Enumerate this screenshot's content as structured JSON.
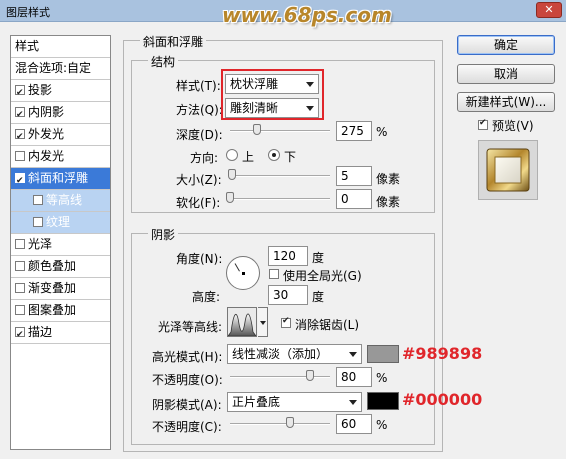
{
  "window": {
    "title": "图层样式",
    "close": "✕",
    "watermark": "www.68ps.com"
  },
  "left_panel": {
    "header": "样式",
    "blend": "混合选项:自定",
    "items": [
      {
        "label": "投影",
        "checked": true
      },
      {
        "label": "内阴影",
        "checked": true
      },
      {
        "label": "外发光",
        "checked": true
      },
      {
        "label": "内发光",
        "checked": false
      },
      {
        "label": "斜面和浮雕",
        "checked": true,
        "selected": true
      },
      {
        "label": "等高线",
        "checked": false,
        "sub": true
      },
      {
        "label": "纹理",
        "checked": false,
        "sub": true
      },
      {
        "label": "光泽",
        "checked": false
      },
      {
        "label": "颜色叠加",
        "checked": false
      },
      {
        "label": "渐变叠加",
        "checked": false
      },
      {
        "label": "图案叠加",
        "checked": false
      },
      {
        "label": "描边",
        "checked": true
      }
    ]
  },
  "bevel": {
    "title": "斜面和浮雕",
    "structure": {
      "title": "结构",
      "style_label": "样式(T):",
      "style_value": "枕状浮雕",
      "technique_label": "方法(Q):",
      "technique_value": "雕刻清晰",
      "depth_label": "深度(D):",
      "depth_value": "275",
      "depth_unit": "%",
      "depth_level": 0.27,
      "direction_label": "方向:",
      "direction_up": "上",
      "direction_down": "下",
      "size_label": "大小(Z):",
      "size_value": "5",
      "size_unit": "像素",
      "size_level": 0.02,
      "soften_label": "软化(F):",
      "soften_value": "0",
      "soften_unit": "像素",
      "soften_level": 0.0
    },
    "shading": {
      "title": "阴影",
      "angle_label": "角度(N):",
      "angle_value": "120",
      "angle_unit": "度",
      "global_light": "使用全局光(G)",
      "altitude_label": "高度:",
      "altitude_value": "30",
      "altitude_unit": "度",
      "gloss_label": "光泽等高线:",
      "anti_alias": "消除锯齿(L)",
      "highlight_label": "高光模式(H):",
      "highlight_value": "线性减淡（添加）",
      "highlight_color": "#989898",
      "highlight_hex": "#989898",
      "opacity1_label": "不透明度(O):",
      "opacity1_value": "80",
      "opacity1_unit": "%",
      "opacity1_level": 0.8,
      "shadow_label": "阴影模式(A):",
      "shadow_value": "正片叠底",
      "shadow_color": "#000000",
      "shadow_hex": "#000000",
      "opacity2_label": "不透明度(C):",
      "opacity2_value": "60",
      "opacity2_unit": "%",
      "opacity2_level": 0.6
    }
  },
  "buttons": {
    "ok": "确定",
    "cancel": "取消",
    "new_style": "新建样式(W)...",
    "preview": "预览(V)"
  },
  "accent_red": "#e0262b"
}
